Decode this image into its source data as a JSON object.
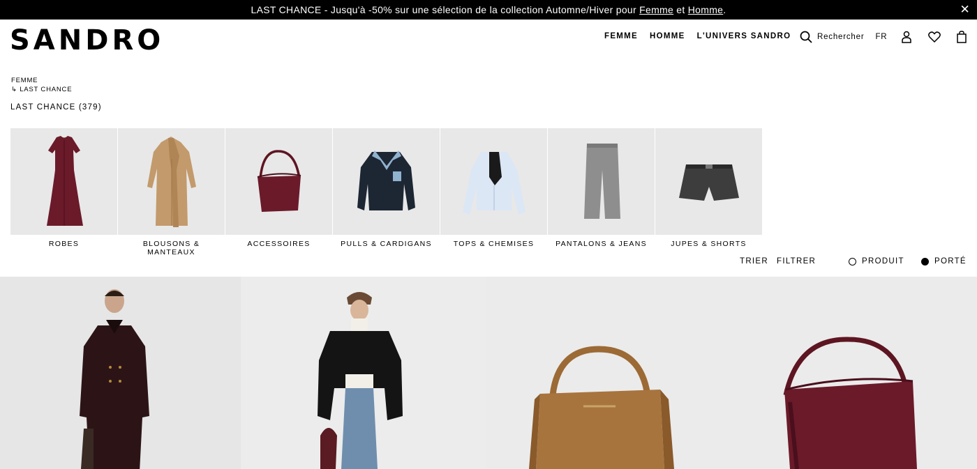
{
  "banner": {
    "text_before": "LAST CHANCE - Jusqu'à -50% sur une sélection de la collection Automne/Hiver pour ",
    "link_femme": "Femme",
    "text_mid": " et ",
    "link_homme": "Homme",
    "text_end": ".",
    "close": "✕"
  },
  "header": {
    "logo": "SANDRO",
    "nav": [
      "FEMME",
      "HOMME",
      "L'UNIVERS SANDRO"
    ],
    "search_label": "Rechercher",
    "language": "FR",
    "icons": [
      "search-icon",
      "account-icon",
      "wishlist-icon",
      "bag-icon"
    ]
  },
  "breadcrumb": {
    "root": "FEMME",
    "current": "↳ LAST CHANCE"
  },
  "page_title": "LAST CHANCE (379)",
  "categories": [
    {
      "label": "ROBES"
    },
    {
      "label": "BLOUSONS & MANTEAUX"
    },
    {
      "label": "ACCESSOIRES"
    },
    {
      "label": "PULLS & CARDIGANS"
    },
    {
      "label": "TOPS & CHEMISES"
    },
    {
      "label": "PANTALONS & JEANS"
    },
    {
      "label": "JUPES & SHORTS"
    }
  ],
  "toolbar": {
    "sort": "TRIER",
    "filter": "FILTRER",
    "view_product": "PRODUIT",
    "view_worn": "PORTÉ",
    "selected_view": "PORTÉ"
  },
  "colors": {
    "banner_bg": "#000000",
    "thumb_bg": "#e8e8e8",
    "burgundy": "#6b1a2a",
    "camel": "#c39a6b",
    "suede": "#9c6a35"
  }
}
